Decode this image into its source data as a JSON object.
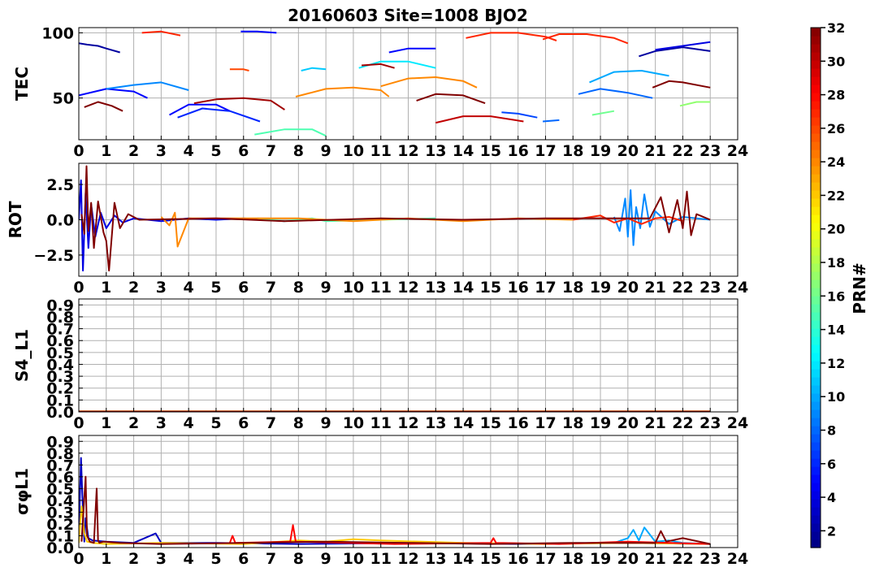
{
  "chart_data": {
    "title": "20160603 Site=1008 BJO2",
    "x_ticks": [
      "0",
      "1",
      "2",
      "3",
      "4",
      "5",
      "6",
      "7",
      "8",
      "9",
      "10",
      "11",
      "12",
      "13",
      "14",
      "15",
      "16",
      "17",
      "18",
      "19",
      "20",
      "21",
      "22",
      "23",
      "24"
    ],
    "xlim": [
      0,
      24
    ],
    "panels": [
      {
        "type": "line",
        "ylabel": "TEC",
        "ylim": [
          18,
          104
        ],
        "yticks": [
          "50",
          "100"
        ],
        "grid": true,
        "series": [
          {
            "prn": 2,
            "x": [
              0.0,
              0.3,
              0.7,
              1.0,
              1.5
            ],
            "y": [
              92,
              91,
              90,
              88,
              85
            ]
          },
          {
            "prn": 2,
            "x": [
              20.4,
              21.0,
              22.0,
              23.0
            ],
            "y": [
              82,
              86,
              89,
              86
            ]
          },
          {
            "prn": 4,
            "x": [
              21.0,
              22.0,
              23.0
            ],
            "y": [
              87,
              90,
              93
            ]
          },
          {
            "prn": 5,
            "x": [
              0.0,
              1.0,
              2.0,
              2.5
            ],
            "y": [
              52,
              57,
              55,
              50
            ]
          },
          {
            "prn": 5,
            "x": [
              3.3,
              4.0,
              5.0,
              5.5
            ],
            "y": [
              37,
              45,
              45,
              40
            ]
          },
          {
            "prn": 5,
            "x": [
              5.9,
              6.5,
              7.2
            ],
            "y": [
              101,
              101,
              100
            ]
          },
          {
            "prn": 5,
            "x": [
              11.3,
              12.0,
              13.0
            ],
            "y": [
              85,
              88,
              88
            ]
          },
          {
            "prn": 6,
            "x": [
              3.6,
              4.5,
              5.5,
              6.6
            ],
            "y": [
              35,
              42,
              40,
              32
            ]
          },
          {
            "prn": 7,
            "x": [
              15.4,
              16.0,
              16.7
            ],
            "y": [
              39,
              38,
              35
            ]
          },
          {
            "prn": 8,
            "x": [
              16.9,
              17.5
            ],
            "y": [
              32,
              33
            ]
          },
          {
            "prn": 8,
            "x": [
              18.2,
              19.0,
              20.0,
              20.9
            ],
            "y": [
              53,
              57,
              54,
              50
            ]
          },
          {
            "prn": 9,
            "x": [
              1.0,
              2.0,
              3.0,
              4.0
            ],
            "y": [
              57,
              60,
              62,
              56
            ]
          },
          {
            "prn": 10,
            "x": [
              18.6,
              19.5,
              20.5,
              21.5
            ],
            "y": [
              62,
              70,
              71,
              67
            ]
          },
          {
            "prn": 11,
            "x": [
              8.1,
              8.5,
              9.0
            ],
            "y": [
              71,
              73,
              72
            ]
          },
          {
            "prn": 12,
            "x": [
              10.2,
              11.0,
              12.0,
              13.0
            ],
            "y": [
              73,
              78,
              78,
              73
            ]
          },
          {
            "prn": 15,
            "x": [
              6.4,
              7.5,
              8.5,
              9.0
            ],
            "y": [
              22,
              26,
              26,
              21
            ]
          },
          {
            "prn": 16,
            "x": [
              18.7,
              19.5
            ],
            "y": [
              37,
              40
            ]
          },
          {
            "prn": 17,
            "x": [
              21.9,
              22.5,
              23.0
            ],
            "y": [
              44,
              47,
              47
            ]
          },
          {
            "prn": 24,
            "x": [
              7.9,
              9.0,
              10.0,
              11.0,
              11.3
            ],
            "y": [
              51,
              57,
              58,
              56,
              51
            ]
          },
          {
            "prn": 24,
            "x": [
              11.0,
              12.0,
              13.0,
              14.0,
              14.5
            ],
            "y": [
              59,
              65,
              66,
              63,
              58
            ]
          },
          {
            "prn": 26,
            "x": [
              5.5,
              6.0,
              6.2
            ],
            "y": [
              72,
              72,
              71
            ]
          },
          {
            "prn": 27,
            "x": [
              2.3,
              3.0,
              3.7
            ],
            "y": [
              100,
              101,
              98
            ]
          },
          {
            "prn": 27,
            "x": [
              14.1,
              15.0,
              16.0,
              17.0,
              17.4
            ],
            "y": [
              96,
              100,
              100,
              97,
              94
            ]
          },
          {
            "prn": 27,
            "x": [
              16.9,
              17.5,
              18.5,
              19.5,
              20.0
            ],
            "y": [
              95,
              99,
              99,
              96,
              92
            ]
          },
          {
            "prn": 30,
            "x": [
              13.0,
              14.0,
              15.0,
              16.2
            ],
            "y": [
              31,
              36,
              36,
              32
            ]
          },
          {
            "prn": 31,
            "x": [
              4.2,
              5.0,
              6.0,
              7.0,
              7.5
            ],
            "y": [
              46,
              49,
              50,
              48,
              41
            ]
          },
          {
            "prn": 31,
            "x": [
              10.3,
              11.0,
              11.5
            ],
            "y": [
              75,
              76,
              73
            ]
          },
          {
            "prn": 32,
            "x": [
              0.2,
              0.7,
              1.2,
              1.6
            ],
            "y": [
              43,
              47,
              44,
              40
            ]
          },
          {
            "prn": 32,
            "x": [
              12.3,
              13.0,
              14.0,
              14.8
            ],
            "y": [
              48,
              53,
              52,
              46
            ]
          },
          {
            "prn": 32,
            "x": [
              20.9,
              21.5,
              22.0,
              23.0
            ],
            "y": [
              58,
              63,
              62,
              58
            ]
          }
        ]
      },
      {
        "type": "line",
        "ylabel": "ROT",
        "ylim": [
          -4,
          4
        ],
        "yticks": [
          "2.5",
          "0.0",
          "−2.5"
        ],
        "grid": true,
        "series": [
          {
            "prn": 4,
            "x": [
              0.0,
              0.08,
              0.15,
              0.25,
              0.35,
              0.45,
              0.6,
              0.8,
              1.0,
              1.3,
              1.6,
              2.0,
              3.0,
              4.0,
              5.0,
              6.0,
              7.5
            ],
            "y": [
              0,
              2.8,
              -3.6,
              1.9,
              -2.0,
              1.1,
              -1.2,
              0.5,
              -0.6,
              0.3,
              -0.2,
              0.1,
              -0.1,
              0.1,
              0,
              0.1,
              -0.1
            ]
          },
          {
            "prn": 9,
            "x": [
              19.5,
              19.7,
              19.9,
              20.0,
              20.1,
              20.2,
              20.3,
              20.45,
              20.6,
              20.8,
              21.0,
              21.5,
              22.0,
              23.0
            ],
            "y": [
              0.2,
              -0.8,
              1.5,
              -1.2,
              2.1,
              -1.8,
              0.9,
              -0.6,
              1.8,
              -0.5,
              0.6,
              -0.3,
              0.2,
              0
            ]
          },
          {
            "prn": 15,
            "x": [
              6.5,
              7.5,
              8.5,
              9.0,
              13.0
            ],
            "y": [
              0.1,
              -0.1,
              0.1,
              -0.1,
              0.1
            ]
          },
          {
            "prn": 24,
            "x": [
              3.0,
              3.3,
              3.5,
              3.6,
              4.0,
              8.0,
              10.0,
              12.0,
              14.0,
              16.0,
              18.0
            ],
            "y": [
              0.2,
              -0.4,
              0.5,
              -1.9,
              0.1,
              0.1,
              -0.1,
              0.1,
              -0.1,
              0.1,
              0
            ]
          },
          {
            "prn": 27,
            "x": [
              18.0,
              19.0,
              19.5,
              20.0,
              20.5,
              21.0,
              21.5,
              22.0
            ],
            "y": [
              0,
              0.3,
              -0.2,
              0.1,
              -0.3,
              0.1,
              0.2,
              -0.1
            ]
          },
          {
            "prn": 32,
            "x": [
              0.1,
              0.2,
              0.28,
              0.35,
              0.45,
              0.55,
              0.7,
              0.9,
              1.0,
              1.1,
              1.3,
              1.5,
              1.8,
              2.2,
              5.0,
              7.5,
              11.0,
              14.0,
              17.0,
              20.8,
              21.2,
              21.5,
              21.8,
              22.0,
              22.15,
              22.3,
              22.5,
              23.0
            ],
            "y": [
              0.4,
              -1.0,
              3.8,
              -0.8,
              1.2,
              -2.0,
              1.3,
              -0.9,
              -1.5,
              -3.6,
              1.2,
              -0.6,
              0.4,
              0,
              0.1,
              -0.1,
              0.1,
              0,
              0.1,
              0.1,
              1.6,
              -0.9,
              1.4,
              -0.6,
              2.0,
              -1.1,
              0.4,
              0
            ]
          }
        ]
      },
      {
        "type": "line",
        "ylabel": "S4_L1",
        "ylim": [
          0,
          0.95
        ],
        "yticks": [
          "0.0",
          "0.1",
          "0.2",
          "0.3",
          "0.4",
          "0.5",
          "0.6",
          "0.7",
          "0.8",
          "0.9"
        ],
        "grid": true,
        "series": [
          {
            "prn": 24,
            "x": [
              0,
              23
            ],
            "y": [
              0.005,
              0.005
            ]
          },
          {
            "prn": 32,
            "x": [
              0,
              23
            ],
            "y": [
              0.003,
              0.003
            ]
          }
        ]
      },
      {
        "type": "line",
        "ylabel": "σφL1",
        "ylim": [
          0,
          0.95
        ],
        "yticks": [
          "0.0",
          "0.1",
          "0.2",
          "0.3",
          "0.4",
          "0.5",
          "0.6",
          "0.7",
          "0.8",
          "0.9"
        ],
        "grid": true,
        "series": [
          {
            "prn": 3,
            "x": [
              0.0,
              0.08,
              0.15,
              0.2,
              0.25,
              0.35,
              0.5,
              1.0,
              2.0,
              2.8,
              3.0,
              5.0,
              8.0,
              12.0,
              16.0,
              20.0,
              23.0
            ],
            "y": [
              0.1,
              0.76,
              0.3,
              0.05,
              0.25,
              0.08,
              0.06,
              0.05,
              0.04,
              0.12,
              0.04,
              0.04,
              0.03,
              0.04,
              0.03,
              0.04,
              0.03
            ]
          },
          {
            "prn": 10,
            "x": [
              19.5,
              20.0,
              20.2,
              20.4,
              20.6,
              21.0,
              21.5,
              22.0,
              23.0
            ],
            "y": [
              0.04,
              0.08,
              0.15,
              0.06,
              0.17,
              0.05,
              0.06,
              0.04,
              0.03
            ]
          },
          {
            "prn": 22,
            "x": [
              0.0,
              0.1,
              0.2,
              0.3,
              0.5,
              1.0,
              3.0,
              6.0,
              8.0,
              9.0,
              10.0,
              11.0,
              14.0,
              17.0,
              20.0,
              23.0
            ],
            "y": [
              0.04,
              0.35,
              0.12,
              0.05,
              0.04,
              0.03,
              0.04,
              0.03,
              0.06,
              0.05,
              0.07,
              0.06,
              0.04,
              0.03,
              0.04,
              0.03
            ]
          },
          {
            "prn": 28,
            "x": [
              5.5,
              5.6,
              5.7,
              7.7,
              7.8,
              7.9,
              11.5,
              15.0,
              15.1,
              15.2,
              17.5,
              20.0,
              23.0
            ],
            "y": [
              0.04,
              0.1,
              0.04,
              0.05,
              0.19,
              0.05,
              0.03,
              0.04,
              0.08,
              0.04,
              0.03,
              0.05,
              0.03
            ]
          },
          {
            "prn": 32,
            "x": [
              0.1,
              0.25,
              0.3,
              0.4,
              0.55,
              0.65,
              0.7,
              0.75,
              0.9,
              1.5,
              3.0,
              6.0,
              9.0,
              12.0,
              15.0,
              18.0,
              21.0,
              21.2,
              21.4,
              22.0,
              23.0
            ],
            "y": [
              0.05,
              0.6,
              0.1,
              0.05,
              0.04,
              0.5,
              0.06,
              0.04,
              0.05,
              0.04,
              0.03,
              0.04,
              0.05,
              0.04,
              0.03,
              0.04,
              0.04,
              0.14,
              0.05,
              0.08,
              0.03
            ]
          }
        ]
      }
    ],
    "colorbar": {
      "label": "PRN#",
      "range": [
        1,
        32
      ],
      "ticks": [
        "2",
        "4",
        "6",
        "8",
        "10",
        "12",
        "14",
        "16",
        "18",
        "20",
        "22",
        "24",
        "26",
        "28",
        "30",
        "32"
      ],
      "colormap": "jet"
    }
  }
}
